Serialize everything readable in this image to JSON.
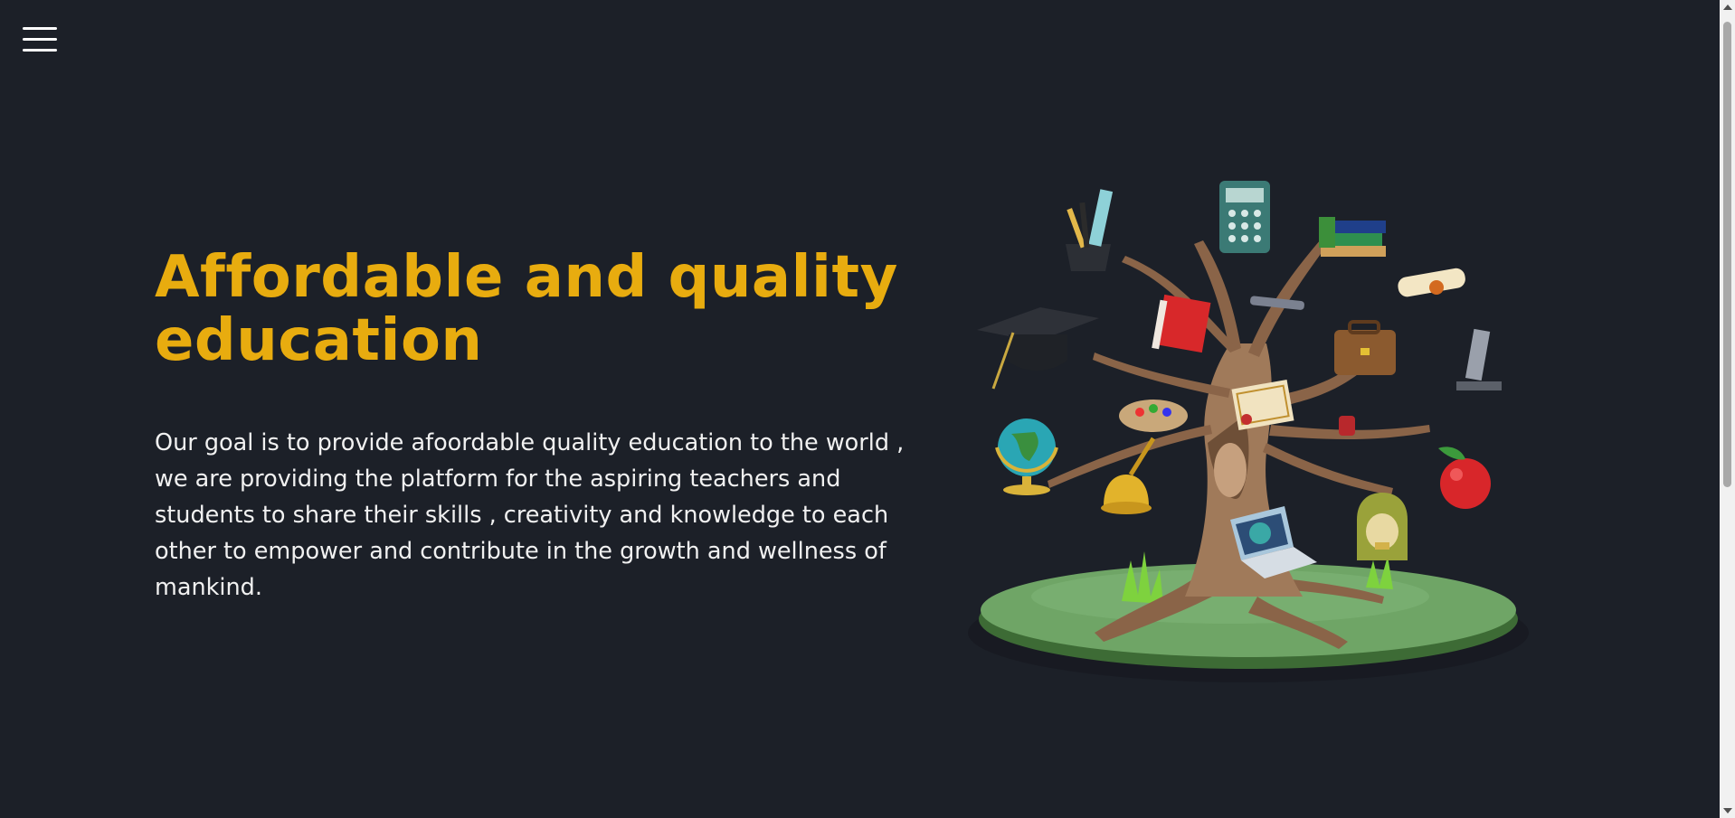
{
  "header": {
    "menu_icon": "hamburger-menu-icon"
  },
  "hero": {
    "title": "Affordable and quality education",
    "description": "Our goal is to provide afoordable quality education to the world , we are providing the platform for the aspiring teachers and students to share their skills , creativity and knowledge to each other to empower and contribute in the growth and wellness of mankind.",
    "title_color": "#e8ac0f",
    "background_color": "#1c2028",
    "illustration": "education-tree-illustration"
  }
}
